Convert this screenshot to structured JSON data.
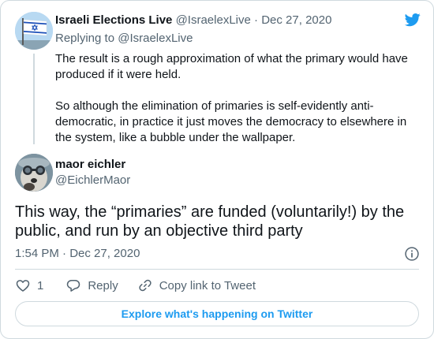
{
  "colors": {
    "brand": "#1d9bf0",
    "text": "#0f1419",
    "muted": "#536471",
    "border": "#cfd9de"
  },
  "parent": {
    "name": "Israeli Elections Live",
    "handle": "@IsraelexLive",
    "separator": "·",
    "date": "Dec 27, 2020",
    "replying_to": "Replying to @IsraelexLive",
    "paragraphs": [
      "The result is a rough approximation of what the primary would have produced if it were held.",
      "So although the elimination of primaries is self-evidently  anti-democratic, in practice it just moves the democracy to elsewhere in the system, like a bubble under the wallpaper."
    ]
  },
  "tweet": {
    "name": "maor eichler",
    "handle": "@EichlerMaor",
    "text": "This way, the “primaries” are funded (voluntarily!) by the public, and run by an objective third party",
    "timestamp": "1:54 PM · Dec 27, 2020"
  },
  "actions": {
    "like_icon": "heart-icon",
    "like_count": "1",
    "reply_icon": "reply-bubble-icon",
    "reply_label": "Reply",
    "copy_icon": "link-icon",
    "copy_label": "Copy link to Tweet"
  },
  "explore_label": "Explore what's happening on Twitter"
}
